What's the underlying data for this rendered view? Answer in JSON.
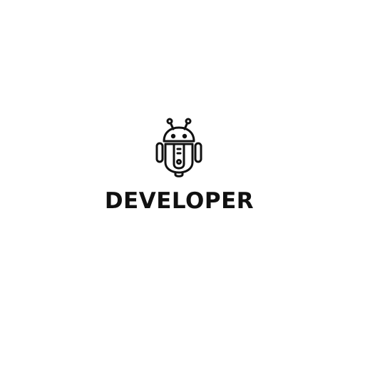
{
  "brand": {
    "wordmark": "DEVELOPER",
    "icon": "robot-icon",
    "color": "#111111",
    "background": "#ffffff"
  }
}
